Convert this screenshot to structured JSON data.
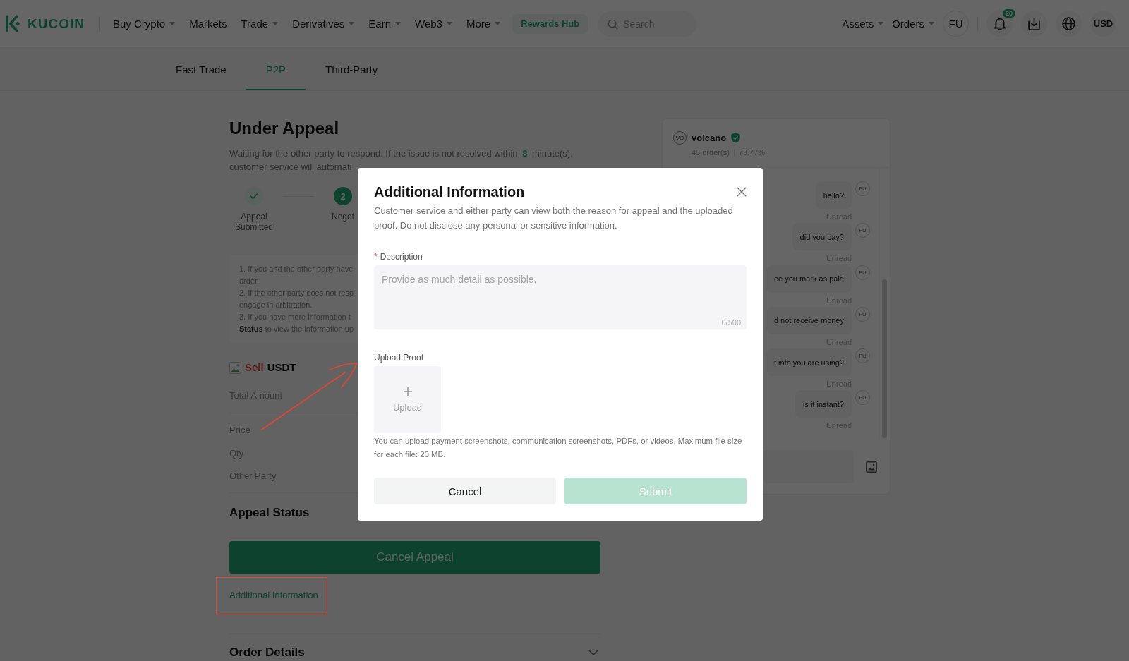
{
  "header": {
    "logo": "KUCOIN",
    "nav": [
      {
        "label": "Buy Crypto",
        "dropdown": true
      },
      {
        "label": "Markets",
        "dropdown": false
      },
      {
        "label": "Trade",
        "dropdown": true
      },
      {
        "label": "Derivatives",
        "dropdown": true
      },
      {
        "label": "Earn",
        "dropdown": true
      },
      {
        "label": "Web3",
        "dropdown": true
      },
      {
        "label": "More",
        "dropdown": true
      }
    ],
    "rewards": "Rewards Hub",
    "search": {
      "placeholder": "Search"
    },
    "menus": [
      {
        "label": "Assets",
        "dropdown": true
      },
      {
        "label": "Orders",
        "dropdown": true
      }
    ],
    "avatar": "FU",
    "notifications": "20",
    "currency": "USD"
  },
  "tabs": [
    {
      "label": "Fast Trade",
      "selected": false
    },
    {
      "label": "P2P",
      "selected": true
    },
    {
      "label": "Third-Party",
      "selected": false
    }
  ],
  "appeal": {
    "title": "Under Appeal",
    "notice": {
      "text": "Waiting for the other party to respond. If the issue is not resolved within",
      "minutes": "8",
      "unit": "minute(s),",
      "continued": "customer service will automati"
    },
    "steps": [
      {
        "label": "Appeal Submitted",
        "done": true
      },
      {
        "number": "2",
        "label": "Negot",
        "done": false
      }
    ],
    "notes": [
      "1. If you and the other party have",
      "order.",
      "2. If the other party does not resp",
      "engage in arbitration.",
      "3. If you have more information t",
      "**Status** to view the information up"
    ],
    "order": {
      "side": "Sell",
      "selling": true,
      "asset": "USDT",
      "total_label": "Total Amount",
      "fields": [
        "Price",
        "Qty",
        "Other Party"
      ]
    },
    "status_title": "Appeal Status",
    "cancel_button": "Cancel Appeal",
    "info_link": "Additional Information",
    "details_title": "Order Details"
  },
  "chat": {
    "avatar": "VO",
    "name": "volcano",
    "verified": true,
    "orders": "45 order(s)",
    "completion": "73.77%",
    "messages": [
      {
        "text": "hello?",
        "status": "Unread",
        "avatar": "FU"
      },
      {
        "text": "did you pay?",
        "status": "Unread",
        "avatar": "FU"
      },
      {
        "text": "ee you mark as paid",
        "status": "Unread",
        "avatar": "FU"
      },
      {
        "text": "d not receive money",
        "status": "Unread",
        "avatar": "FU"
      },
      {
        "text": "t info you are using?",
        "status": "Unread",
        "avatar": "FU"
      },
      {
        "text": "is it instant?",
        "status": "Unread",
        "avatar": "FU"
      }
    ]
  },
  "modal": {
    "title": "Additional Information",
    "intro": "Customer service and either party can view both the reason for appeal and the uploaded proof. Do not disclose any personal or sensitive information.",
    "description": {
      "required_mark": "*",
      "label": "Description",
      "placeholder": "Provide as much detail as possible.",
      "counter": "0/500"
    },
    "upload": {
      "label": "Upload Proof",
      "button": "Upload",
      "hint": "You can upload payment screenshots, communication screenshots, PDFs, or videos. Maximum file size for each file: 20 MB."
    },
    "buttons": [
      {
        "label": "Cancel",
        "kind": "secondary",
        "disabled": false
      },
      {
        "label": "Submit",
        "kind": "primary",
        "disabled": true
      }
    ]
  }
}
